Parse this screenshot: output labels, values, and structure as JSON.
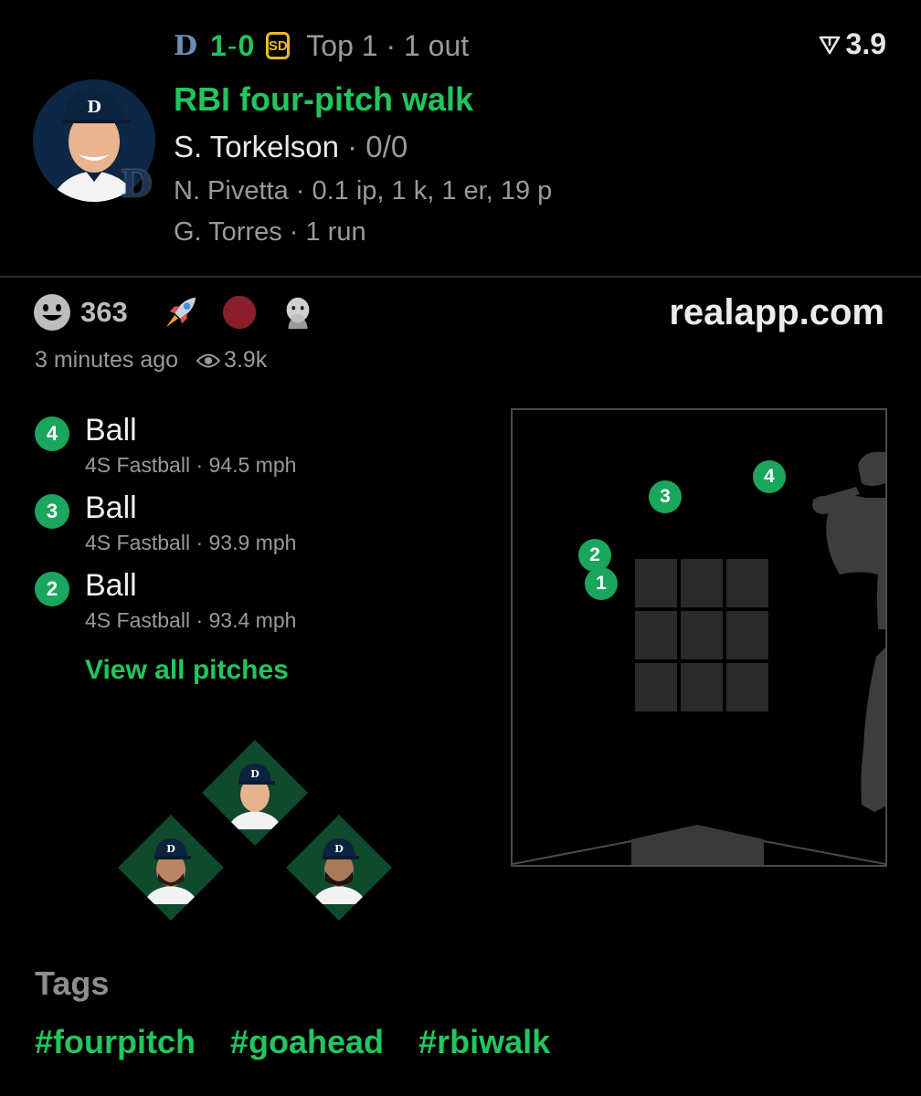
{
  "header": {
    "away_team_icon": "tigers-logo-icon",
    "away_team_letter": "D",
    "score_away": "1",
    "score_sep": "-",
    "score_home": "0",
    "home_team_icon": "padres-logo-icon",
    "home_team_letter": "SD",
    "inning_text": "Top 1 · 1 out",
    "odds_icon": "signal-triangle-icon",
    "odds_value": "3.9"
  },
  "play": {
    "headline": "RBI four-pitch walk",
    "batter_name": "S. Torkelson",
    "batter_stat": " · 0/0",
    "pitcher_line": "N. Pivetta · 0.1 ip, 1 k, 1 er, 19 p",
    "runner_line": "G. Torres · 1 run",
    "avatar_badge_letter": "D",
    "accent_color": "#22c55e"
  },
  "reactions": {
    "smiley_icon": "smiley-face-icon",
    "count": "363",
    "emojis": [
      "rocket-icon",
      "red-dot-icon",
      "hand-over-mouth-icon"
    ],
    "brand": "realapp.com",
    "time_ago": "3 minutes ago",
    "views_icon": "eye-icon",
    "views": "3.9k"
  },
  "pitches": [
    {
      "number": "4",
      "result": "Ball",
      "type": "4S Fastball",
      "sep": " · ",
      "speed": "94.5 mph"
    },
    {
      "number": "3",
      "result": "Ball",
      "type": "4S Fastball",
      "sep": " · ",
      "speed": "93.9 mph"
    },
    {
      "number": "2",
      "result": "Ball",
      "type": "4S Fastball",
      "sep": " · ",
      "speed": "93.4 mph"
    }
  ],
  "view_all_label": "View all pitches",
  "strike_zone": {
    "pitch_labels": [
      "1",
      "2",
      "3",
      "4"
    ],
    "batter_icon": "batter-silhouette-icon"
  },
  "tags": {
    "title": "Tags",
    "items": [
      "#fourpitch",
      "#goahead",
      "#rbiwalk"
    ]
  }
}
